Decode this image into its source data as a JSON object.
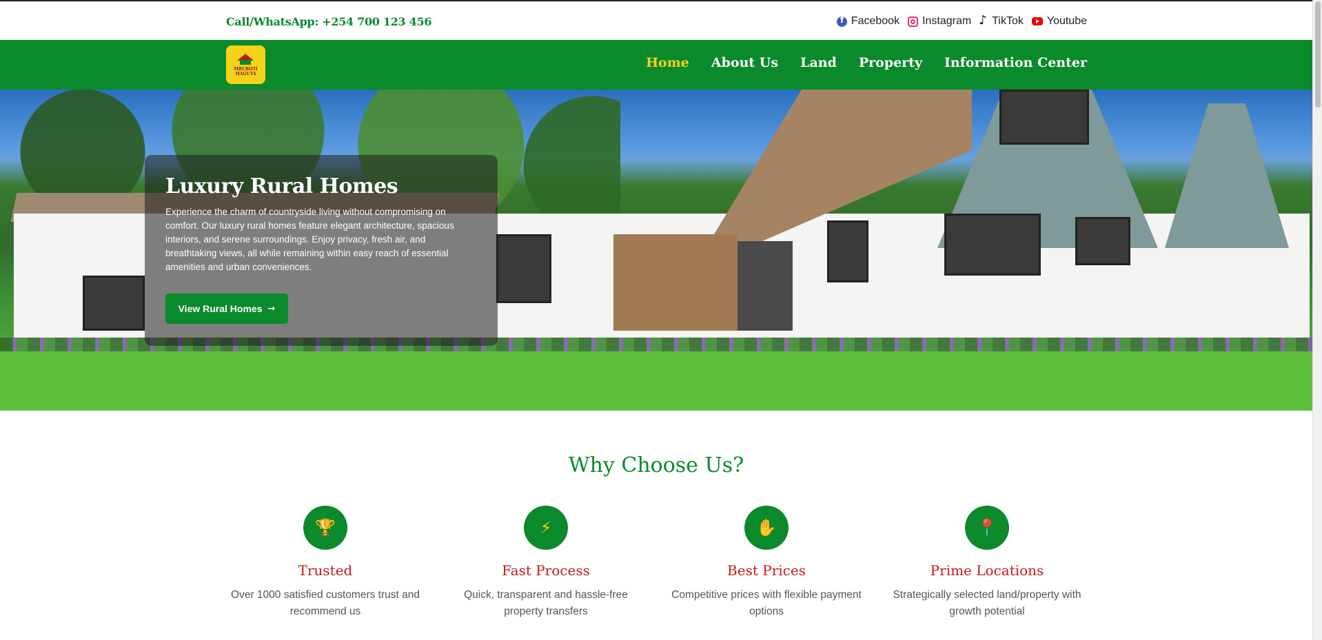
{
  "topbar": {
    "call_label": "Call/WhatsApp:",
    "phone": "+254 700 123 456",
    "socials": [
      {
        "label": "Facebook",
        "icon": "facebook-icon"
      },
      {
        "label": "Instagram",
        "icon": "instagram-icon"
      },
      {
        "label": "TikTok",
        "icon": "tiktok-icon"
      },
      {
        "label": "Youtube",
        "icon": "youtube-icon"
      }
    ]
  },
  "nav": {
    "logo_line1": "MBUROTI",
    "logo_line2": "MAGUTA",
    "items": [
      {
        "label": "Home",
        "active": true
      },
      {
        "label": "About Us",
        "active": false
      },
      {
        "label": "Land",
        "active": false
      },
      {
        "label": "Property",
        "active": false
      },
      {
        "label": "Information Center",
        "active": false
      }
    ]
  },
  "hero": {
    "title": "Luxury Rural Homes",
    "description": "Experience the charm of countryside living without compromising on comfort. Our luxury rural homes feature elegant architecture, spacious interiors, and serene surroundings. Enjoy privacy, fresh air, and breathtaking views, all while remaining within easy reach of essential amenities and urban conveniences.",
    "button_label": "View Rural Homes"
  },
  "why": {
    "title": "Why Choose Us?",
    "features": [
      {
        "icon": "trophy-icon",
        "title": "Trusted",
        "text": "Over 1000 satisfied customers trust and recommend us"
      },
      {
        "icon": "lightning-icon",
        "title": "Fast Process",
        "text": "Quick, transparent and hassle-free property transfers"
      },
      {
        "icon": "hand-coin-icon",
        "title": "Best Prices",
        "text": "Competitive prices with flexible payment options"
      },
      {
        "icon": "location-pin-icon",
        "title": "Prime Locations",
        "text": "Strategically selected land/property with growth potential"
      }
    ]
  },
  "colors": {
    "brand_green": "#0a8a2a",
    "accent_yellow": "#f6d21a",
    "feature_title_red": "#c41a1a"
  }
}
